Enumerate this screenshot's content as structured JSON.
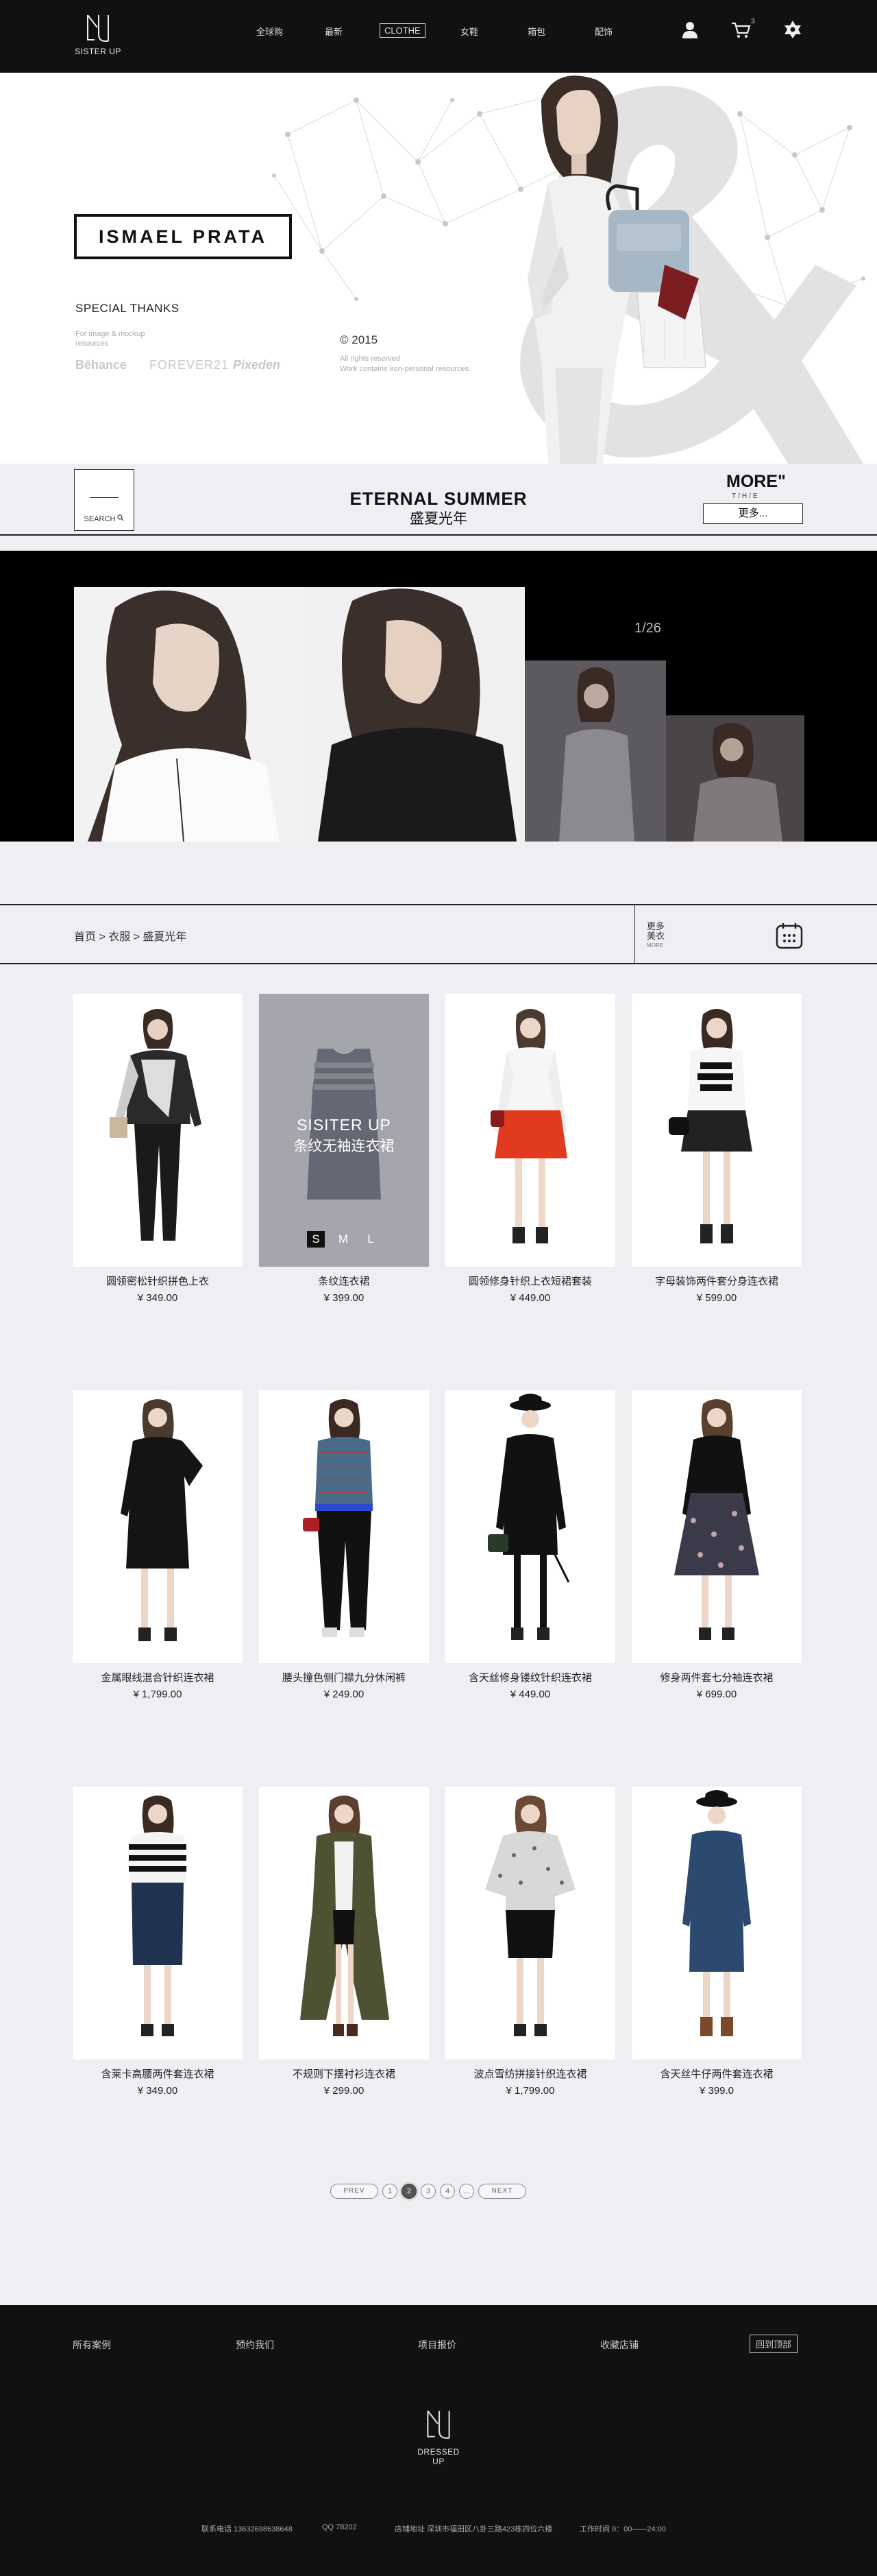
{
  "header": {
    "logo_text": "SISTER UP",
    "nav": [
      "全球购",
      "最新",
      "CLOTHE",
      "女鞋",
      "箱包",
      "配饰"
    ],
    "cart_count": "3"
  },
  "hero": {
    "brand": "ISMAEL PRATA",
    "thanks_title": "SPECIAL THANKS",
    "thanks_sub": "For image & mockup resources",
    "partners": [
      "Bēhance",
      "FOREVER21",
      "Pixeden"
    ],
    "year": "© 2015",
    "rights_1": "All rights reserved",
    "rights_2": "Work contains iron-personal resources."
  },
  "banner": {
    "search_label": "SEARCH",
    "title": "ETERNAL SUMMER",
    "subtitle": "盛夏光年",
    "more_title": "MORE\"",
    "more_sub": "T/H/E",
    "more_button": "更多..."
  },
  "gallery": {
    "counter": "1/26"
  },
  "breadcrumb": {
    "path": "首页 > 衣服 > 盛夏光年",
    "more_1": "更多",
    "more_2": "美衣",
    "more_3": "MORE"
  },
  "products": [
    {
      "name": "圆领密松针织拼色上衣",
      "price": "¥ 349.00"
    },
    {
      "name": "条纹连衣裙",
      "price": "¥ 399.00"
    },
    {
      "name": "圆领修身针织上衣短裙套装",
      "price": "¥ 449.00"
    },
    {
      "name": "字母装饰两件套分身连衣裙",
      "price": "¥ 599.00"
    },
    {
      "name": "金属眼线混合针织连衣裙",
      "price": "¥ 1,799.00"
    },
    {
      "name": "腰头撞色侧门襟九分休闲裤",
      "price": "¥ 249.00"
    },
    {
      "name": "含天丝修身镂纹针织连衣裙",
      "price": "¥ 449.00"
    },
    {
      "name": "修身两件套七分袖连衣裙",
      "price": "¥ 699.00"
    },
    {
      "name": "含莱卡高腰两件套连衣裙",
      "price": "¥ 349.00"
    },
    {
      "name": "不规则下摆衬衫连衣裙",
      "price": "¥ 299.00"
    },
    {
      "name": "波点雪纺拼接针织连衣裙",
      "price": "¥ 1,799.00"
    },
    {
      "name": "含天丝牛仔两件套连衣裙",
      "price": "¥ 399.0"
    }
  ],
  "hover_card": {
    "brand": "SISITER UP",
    "name": "条纹无袖连衣裙",
    "sizes": [
      "S",
      "M",
      "L"
    ]
  },
  "pagination": [
    "PREV",
    "1",
    "2",
    "3",
    "4",
    "...",
    "NEXT"
  ],
  "footer": {
    "links": [
      "所有案例",
      "预约我们",
      "项目报价",
      "收藏店铺"
    ],
    "back_top": "回到顶部",
    "logo_text": "DRESSED UP",
    "phone": "联系电话  13632698638648",
    "qq": "QQ  78202",
    "address": "店铺地址  深圳市福田区八卦三路423栋四位六楼",
    "hours": "工作时间  9：00——24:00"
  },
  "colors": {
    "dark": "#111111",
    "bg": "#eeeef3",
    "accent": "#de3a21"
  }
}
